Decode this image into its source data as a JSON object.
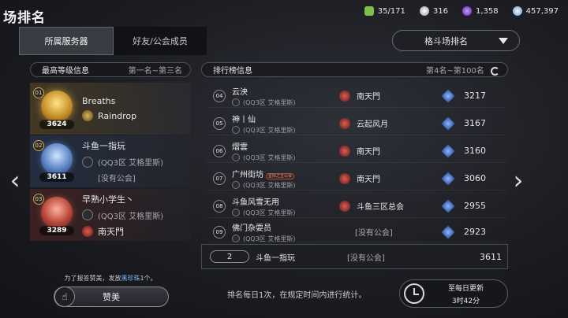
{
  "header": {
    "title": "场排名",
    "currencies": [
      {
        "icon": "stamina-icon",
        "value": "35/171",
        "color": "#7fbf4a"
      },
      {
        "icon": "silver-coin-icon",
        "value": "316",
        "color": "#d9d9d9"
      },
      {
        "icon": "purple-gem-icon",
        "value": "1,358",
        "color": "#8a4fd8"
      },
      {
        "icon": "diamond-icon",
        "value": "457,397",
        "color": "#9fc3e6"
      }
    ]
  },
  "tabs": [
    {
      "label": "所属服务器",
      "active": true
    },
    {
      "label": "好友/公会成员",
      "active": false
    }
  ],
  "dropdown": {
    "label": "格斗场排名"
  },
  "top_panel": {
    "title": "最高等级信息",
    "range": "第一名~第三名"
  },
  "rank_panel": {
    "title": "排行榜信息",
    "range": "第4名~第100名"
  },
  "top_three": [
    {
      "rank": "01",
      "score": "3624",
      "name": "Breaths",
      "server": "(QQ3区 艾格里斯)",
      "guild": "Raindrop"
    },
    {
      "rank": "02",
      "score": "3611",
      "name": "斗鱼一指玩",
      "server": "(QQ3区 艾格里斯)",
      "guild": "[没有公会]"
    },
    {
      "rank": "03",
      "score": "3289",
      "name": "早熟小学生丶",
      "server": "(QQ3区 艾格里斯)",
      "guild": "南天門"
    }
  ],
  "rankings": [
    {
      "rank": "04",
      "name": "云泱",
      "server": "(QQ3区 艾格里斯)",
      "guild": "南天門",
      "score": "3217"
    },
    {
      "rank": "05",
      "name": "神丨仙",
      "server": "(QQ3区 艾格里斯)",
      "guild": "云起风月",
      "score": "3167"
    },
    {
      "rank": "06",
      "name": "熠雲",
      "server": "(QQ3区 艾格里斯)",
      "guild": "南天門",
      "score": "3160"
    },
    {
      "rank": "07",
      "name": "广州街坊",
      "server": "(QQ3区 艾格里斯)",
      "guild": "南天門",
      "score": "3060",
      "tag": "星际之主公会"
    },
    {
      "rank": "08",
      "name": "斗鱼风雪无用",
      "server": "(QQ3区 艾格里斯)",
      "guild": "斗鱼三区总会",
      "score": "2955"
    },
    {
      "rank": "09",
      "name": "佛门杂耍员",
      "server": "(QQ3区 艾格里斯)",
      "guild": "[没有公会]",
      "score": "2923"
    }
  ],
  "self": {
    "rank": "2",
    "name": "斗鱼一指玩",
    "guild": "[没有公会]",
    "score": "3611"
  },
  "praise": {
    "note_before": "为了报答赞美，发放",
    "note_highlight": "黑珍珠",
    "note_after": "1个。",
    "button": "赞美"
  },
  "footer_note": "排名每日1次，在规定时间内进行统计。",
  "daily_update": {
    "title": "至每日更新",
    "time": "3时42分"
  }
}
